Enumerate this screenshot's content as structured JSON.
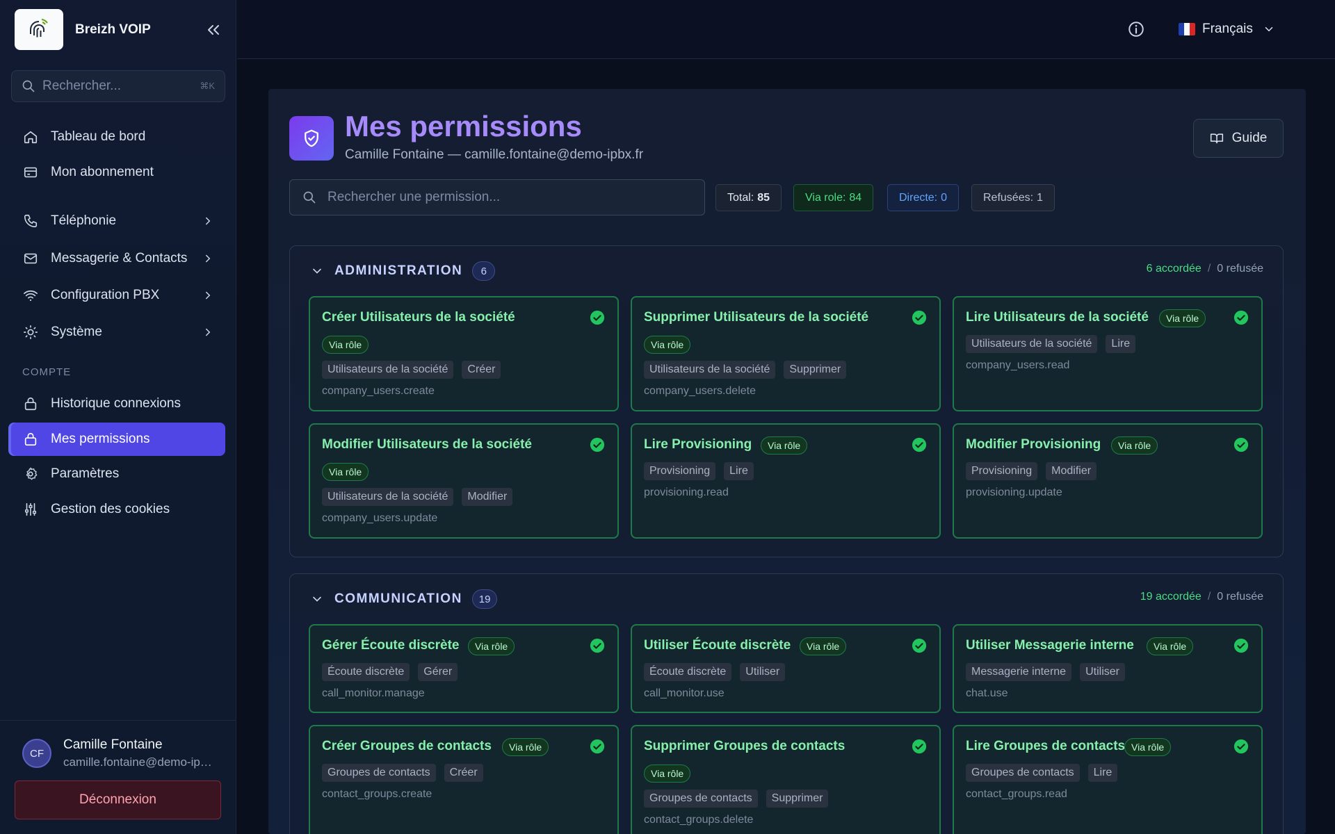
{
  "sidebar": {
    "brand_name": "Breizh VOIP",
    "search_placeholder": "Rechercher...",
    "search_shortcut": "⌘K",
    "nav": [
      {
        "label": "Tableau de bord",
        "icon": "home-icon"
      },
      {
        "label": "Mon abonnement",
        "icon": "credit-card-icon"
      },
      {
        "label": "Téléphonie",
        "icon": "phone-icon"
      },
      {
        "label": "Messagerie & Contacts",
        "icon": "mail-icon"
      },
      {
        "label": "Configuration PBX",
        "icon": "wifi-icon"
      },
      {
        "label": "Système",
        "icon": "lightbulb-icon"
      }
    ],
    "section_label": "COMPTE",
    "account_nav": [
      {
        "label": "Historique connexions",
        "icon": "lock-icon"
      },
      {
        "label": "Mes permissions",
        "icon": "lock-icon"
      },
      {
        "label": "Paramètres",
        "icon": "gear-icon"
      },
      {
        "label": "Gestion des cookies",
        "icon": "sliders-icon"
      }
    ],
    "user": {
      "initials": "CF",
      "name": "Camille Fontaine",
      "email": "camille.fontaine@demo-ipbx.fr"
    },
    "logout_label": "Déconnexion"
  },
  "topbar": {
    "language": "Français"
  },
  "page": {
    "title": "Mes permissions",
    "subtitle": "Camille Fontaine — camille.fontaine@demo-ipbx.fr",
    "guide_label": "Guide",
    "search_placeholder": "Rechercher une permission...",
    "stats": {
      "total_label": "Total:",
      "total": "85",
      "via_role_label": "Via role:",
      "via_role": "84",
      "direct_label": "Directe:",
      "direct": "0",
      "refused_label": "Refusées:",
      "refused": "1"
    }
  },
  "groups": [
    {
      "name": "ADMINISTRATION",
      "count": "6",
      "granted": "6 accordée",
      "sep": "/",
      "refused": "0 refusée",
      "cards": [
        {
          "title": "Créer Utilisateurs de la société",
          "badge": "Via rôle",
          "tags": [
            "Utilisateurs de la société",
            "Créer"
          ],
          "code": "company_users.create"
        },
        {
          "title": "Supprimer Utilisateurs de la société",
          "badge": "Via rôle",
          "tags": [
            "Utilisateurs de la société",
            "Supprimer"
          ],
          "code": "company_users.delete"
        },
        {
          "title": "Lire Utilisateurs de la société",
          "badge": "Via rôle",
          "tags": [
            "Utilisateurs de la société",
            "Lire"
          ],
          "code": "company_users.read"
        },
        {
          "title": "Modifier Utilisateurs de la société",
          "badge": "Via rôle",
          "tags": [
            "Utilisateurs de la société",
            "Modifier"
          ],
          "code": "company_users.update"
        },
        {
          "title": "Lire Provisioning",
          "badge": "Via rôle",
          "tags": [
            "Provisioning",
            "Lire"
          ],
          "code": "provisioning.read"
        },
        {
          "title": "Modifier Provisioning",
          "badge": "Via rôle",
          "tags": [
            "Provisioning",
            "Modifier"
          ],
          "code": "provisioning.update"
        }
      ]
    },
    {
      "name": "COMMUNICATION",
      "count": "19",
      "granted": "19 accordée",
      "sep": "/",
      "refused": "0 refusée",
      "cards": [
        {
          "title": "Gérer Écoute discrète",
          "badge": "Via rôle",
          "tags": [
            "Écoute discrète",
            "Gérer"
          ],
          "code": "call_monitor.manage"
        },
        {
          "title": "Utiliser Écoute discrète",
          "badge": "Via rôle",
          "tags": [
            "Écoute discrète",
            "Utiliser"
          ],
          "code": "call_monitor.use"
        },
        {
          "title": "Utiliser Messagerie interne",
          "badge": "Via rôle",
          "tags": [
            "Messagerie interne",
            "Utiliser"
          ],
          "code": "chat.use"
        },
        {
          "title": "Créer Groupes de contacts",
          "badge": "Via rôle",
          "tags": [
            "Groupes de contacts",
            "Créer"
          ],
          "code": "contact_groups.create"
        },
        {
          "title": "Supprimer Groupes de contacts",
          "badge": "Via rôle",
          "tags": [
            "Groupes de contacts",
            "Supprimer"
          ],
          "code": "contact_groups.delete"
        },
        {
          "title": "Lire Groupes de contacts",
          "badge": "Via rôle",
          "tags": [
            "Groupes de contacts",
            "Lire"
          ],
          "code": "contact_groups.read"
        }
      ]
    }
  ],
  "colors": {
    "accent": "#4f46e5",
    "title": "#a78bfa",
    "granted_border": "#1f7a4a",
    "granted_text": "#86efac",
    "check": "#22c55e"
  }
}
